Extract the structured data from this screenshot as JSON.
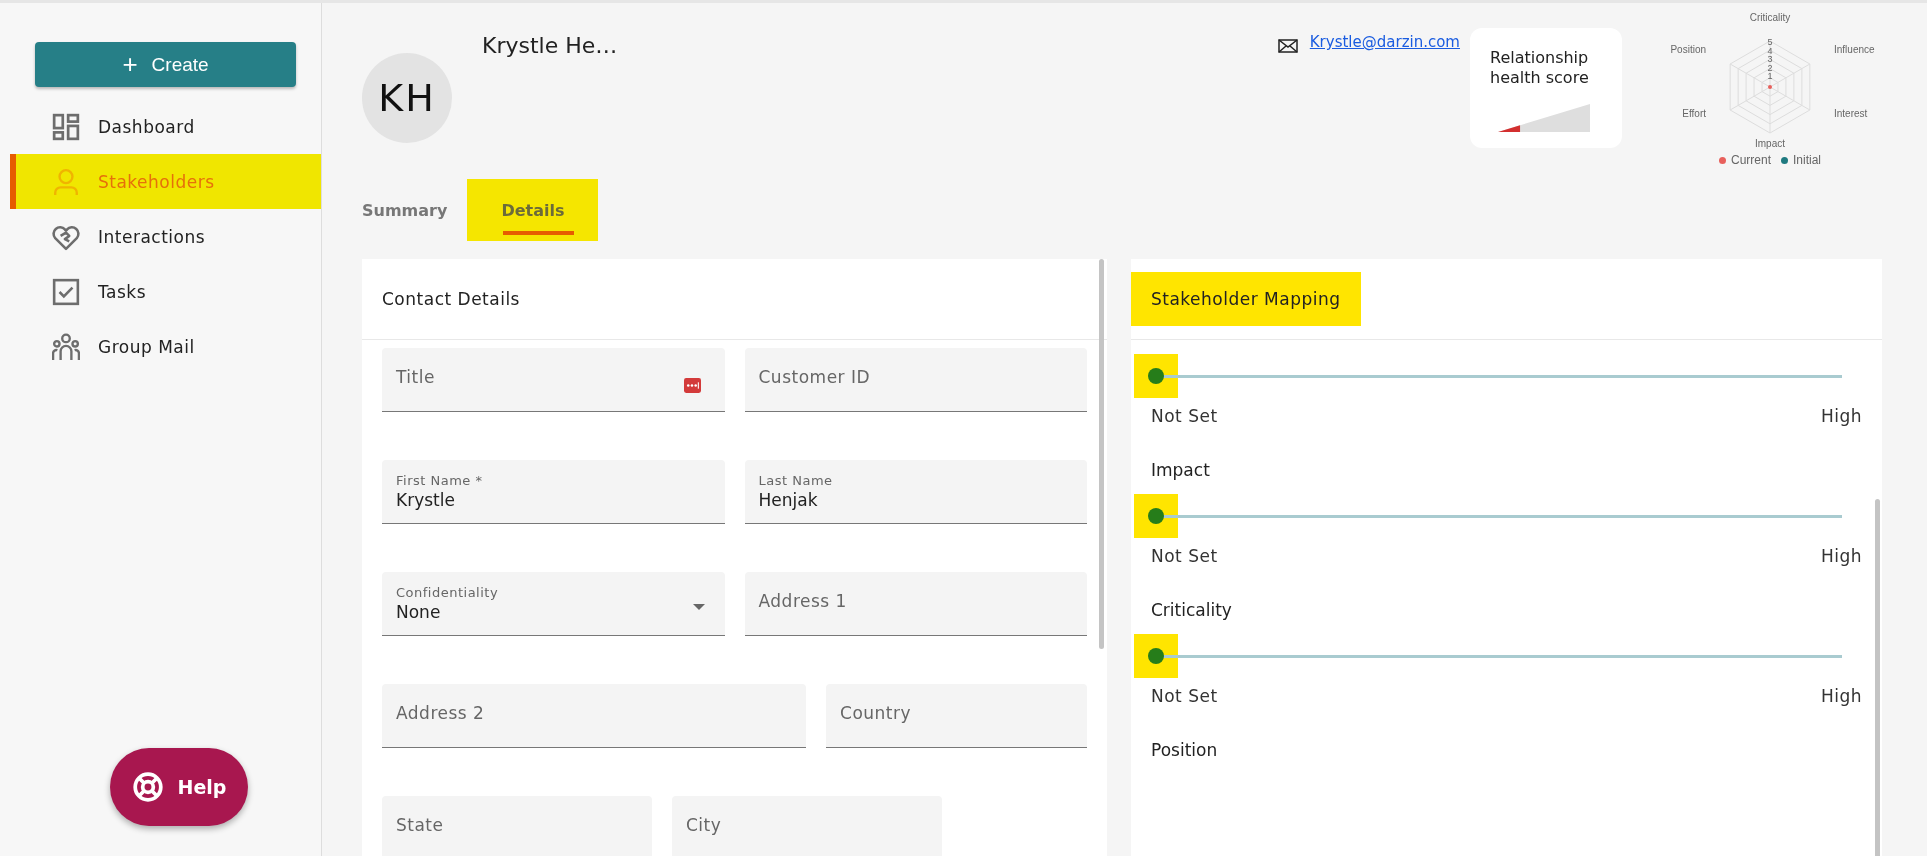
{
  "sidebar": {
    "create_button": {
      "icon": "+",
      "label": "Create"
    },
    "items": [
      {
        "label": "Dashboard",
        "selected": false,
        "highlighted": false
      },
      {
        "label": "Stakeholders",
        "selected": true,
        "highlighted": true
      },
      {
        "label": "Interactions",
        "selected": false,
        "highlighted": false
      },
      {
        "label": "Tasks",
        "selected": false,
        "highlighted": false
      },
      {
        "label": "Group Mail",
        "selected": false,
        "highlighted": false
      }
    ],
    "help_button": {
      "label": "Help"
    }
  },
  "profile": {
    "initials": "KH",
    "name": "Krystle He…",
    "email": "Krystle@darzin.com"
  },
  "health_score": {
    "title": "Relationship health score",
    "level": 0.24
  },
  "radar": {
    "axes": [
      "Criticality",
      "Position",
      "Influence",
      "Effort",
      "Interest",
      "Impact"
    ],
    "ticks": [
      "5",
      "4",
      "3",
      "2",
      "1"
    ],
    "legend": [
      {
        "label": "Current",
        "color": "#e8605c"
      },
      {
        "label": "Initial",
        "color": "#1f7a80"
      }
    ]
  },
  "tabs": [
    {
      "label": "Summary",
      "selected": false,
      "highlighted": false
    },
    {
      "label": "Details",
      "selected": true,
      "highlighted": true
    }
  ],
  "contact_details": {
    "title": "Contact Details",
    "rows": [
      [
        {
          "kind": "text",
          "label": "Title",
          "badge": true
        },
        {
          "kind": "text",
          "label": "Customer ID",
          "badge": false
        }
      ],
      [
        {
          "kind": "text",
          "label": "First Name *",
          "value": "Krystle",
          "badge": false
        },
        {
          "kind": "text",
          "label": "Last Name",
          "value": "Henjak",
          "badge": false
        }
      ],
      [
        {
          "kind": "select",
          "label": "Confidentiality",
          "value": "None",
          "badge": false
        },
        {
          "kind": "text",
          "label": "Address 1",
          "badge": false
        }
      ],
      [
        {
          "kind": "text",
          "label": "Address 2",
          "badge": false
        },
        {
          "kind": "text",
          "label": "Country",
          "badge": false
        }
      ],
      [
        {
          "kind": "text",
          "label": "State",
          "badge": false
        },
        {
          "kind": "text",
          "label": "City",
          "badge": false
        }
      ]
    ]
  },
  "stakeholder_mapping": {
    "title": "Stakeholder Mapping",
    "title_highlighted": true,
    "rows": [
      {
        "kind": "slider",
        "level": 0,
        "highlighted": true,
        "min_label": "Not Set",
        "max_label": "High"
      },
      {
        "kind": "heading",
        "label": "Impact"
      },
      {
        "kind": "slider",
        "level": 0,
        "highlighted": true,
        "min_label": "Not Set",
        "max_label": "High"
      },
      {
        "kind": "heading",
        "label": "Criticality"
      },
      {
        "kind": "slider",
        "level": 0,
        "highlighted": true,
        "min_label": "Not Set",
        "max_label": "High"
      },
      {
        "kind": "heading",
        "label": "Position"
      }
    ]
  }
}
